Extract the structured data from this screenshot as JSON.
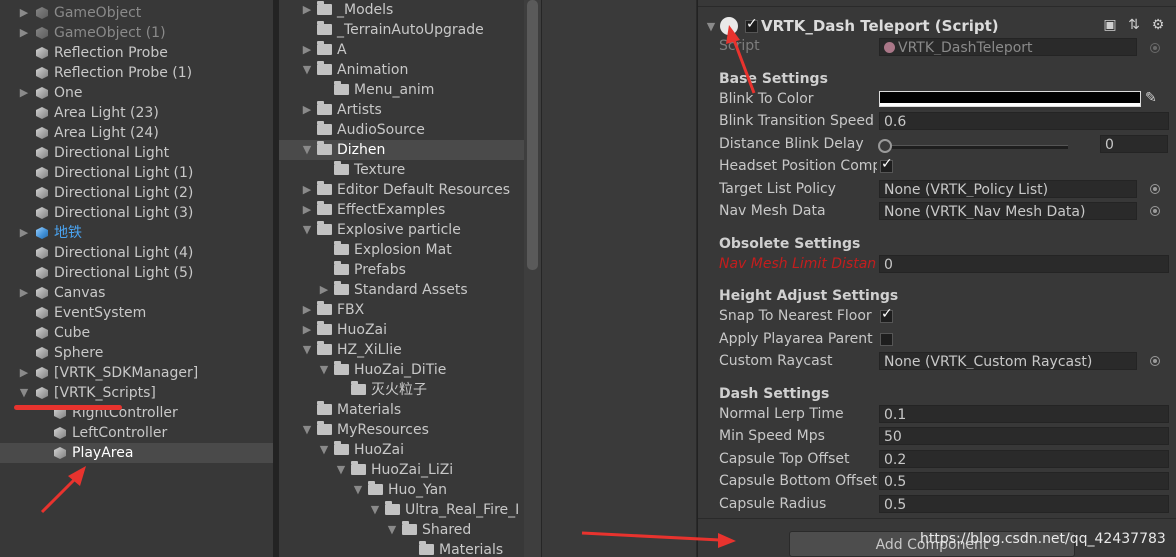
{
  "hierarchy": {
    "rows": [
      {
        "label": "GameObject",
        "arrow": "▶",
        "icon": "cube-dim",
        "style": "dim"
      },
      {
        "label": "GameObject (1)",
        "arrow": "▶",
        "icon": "cube-dim",
        "style": "dim"
      },
      {
        "label": "Reflection Probe",
        "arrow": "",
        "icon": "cube",
        "style": ""
      },
      {
        "label": "Reflection Probe (1)",
        "arrow": "",
        "icon": "cube",
        "style": ""
      },
      {
        "label": "One",
        "arrow": "▶",
        "icon": "cube",
        "style": ""
      },
      {
        "label": "Area Light (23)",
        "arrow": "",
        "icon": "cube",
        "style": ""
      },
      {
        "label": "Area Light (24)",
        "arrow": "",
        "icon": "cube",
        "style": ""
      },
      {
        "label": "Directional Light",
        "arrow": "",
        "icon": "cube",
        "style": ""
      },
      {
        "label": "Directional Light (1)",
        "arrow": "",
        "icon": "cube",
        "style": ""
      },
      {
        "label": "Directional Light (2)",
        "arrow": "",
        "icon": "cube",
        "style": ""
      },
      {
        "label": "Directional Light (3)",
        "arrow": "",
        "icon": "cube",
        "style": ""
      },
      {
        "label": "地铁",
        "arrow": "▶",
        "icon": "cube-blue",
        "style": "blue"
      },
      {
        "label": "Directional Light (4)",
        "arrow": "",
        "icon": "cube",
        "style": ""
      },
      {
        "label": "Directional Light (5)",
        "arrow": "",
        "icon": "cube",
        "style": ""
      },
      {
        "label": "Canvas",
        "arrow": "▶",
        "icon": "cube",
        "style": ""
      },
      {
        "label": "EventSystem",
        "arrow": "",
        "icon": "cube",
        "style": ""
      },
      {
        "label": "Cube",
        "arrow": "",
        "icon": "cube",
        "style": ""
      },
      {
        "label": "Sphere",
        "arrow": "",
        "icon": "cube",
        "style": ""
      },
      {
        "label": "[VRTK_SDKManager]",
        "arrow": "▶",
        "icon": "cube",
        "style": ""
      },
      {
        "label": "[VRTK_Scripts]",
        "arrow": "▼",
        "icon": "cube",
        "style": ""
      },
      {
        "label": "RightController",
        "arrow": "",
        "icon": "cube",
        "style": "",
        "indent": 1
      },
      {
        "label": "LeftController",
        "arrow": "",
        "icon": "cube",
        "style": "",
        "indent": 1
      },
      {
        "label": "PlayArea",
        "arrow": "",
        "icon": "cube",
        "style": "",
        "indent": 1,
        "selected": true
      }
    ]
  },
  "project": {
    "rows": [
      {
        "label": "_Models",
        "arrow": "▶",
        "indent": 0
      },
      {
        "label": "_TerrainAutoUpgrade",
        "arrow": "",
        "indent": 0
      },
      {
        "label": "A",
        "arrow": "▶",
        "indent": 0
      },
      {
        "label": "Animation",
        "arrow": "▼",
        "indent": 0
      },
      {
        "label": "Menu_anim",
        "arrow": "",
        "indent": 1
      },
      {
        "label": "Artists",
        "arrow": "▶",
        "indent": 0
      },
      {
        "label": "AudioSource",
        "arrow": "",
        "indent": 0
      },
      {
        "label": "Dizhen",
        "arrow": "▼",
        "indent": 0,
        "selected": true
      },
      {
        "label": "Texture",
        "arrow": "",
        "indent": 1
      },
      {
        "label": "Editor Default Resources",
        "arrow": "▶",
        "indent": 0
      },
      {
        "label": "EffectExamples",
        "arrow": "▶",
        "indent": 0
      },
      {
        "label": "Explosive particle",
        "arrow": "▼",
        "indent": 0
      },
      {
        "label": "Explosion Mat",
        "arrow": "",
        "indent": 1
      },
      {
        "label": "Prefabs",
        "arrow": "",
        "indent": 1
      },
      {
        "label": "Standard Assets",
        "arrow": "▶",
        "indent": 1
      },
      {
        "label": "FBX",
        "arrow": "▶",
        "indent": 0
      },
      {
        "label": "HuoZai",
        "arrow": "▶",
        "indent": 0
      },
      {
        "label": "HZ_XiLlie",
        "arrow": "▼",
        "indent": 0
      },
      {
        "label": "HuoZai_DiTie",
        "arrow": "▼",
        "indent": 1
      },
      {
        "label": "灭火粒子",
        "arrow": "",
        "indent": 2
      },
      {
        "label": "Materials",
        "arrow": "",
        "indent": 0
      },
      {
        "label": "MyResources",
        "arrow": "▼",
        "indent": 0
      },
      {
        "label": "HuoZai",
        "arrow": "▼",
        "indent": 1
      },
      {
        "label": "HuoZai_LiZi",
        "arrow": "▼",
        "indent": 2
      },
      {
        "label": "Huo_Yan",
        "arrow": "▼",
        "indent": 3
      },
      {
        "label": "Ultra_Real_Fire_I",
        "arrow": "▼",
        "indent": 4
      },
      {
        "label": "Shared",
        "arrow": "▼",
        "indent": 5
      },
      {
        "label": "Materials",
        "arrow": "",
        "indent": 6
      }
    ]
  },
  "inspector": {
    "component_title": "VRTK_Dash Teleport (Script)",
    "script_label": "Script",
    "script_value": "VRTK_DashTeleport",
    "base_settings": "Base Settings",
    "blink_to_color": "Blink To Color",
    "blink_transition_speed": "Blink Transition Speed",
    "blink_transition_speed_value": "0.6",
    "distance_blink_delay": "Distance Blink Delay",
    "distance_blink_delay_value": "0",
    "distance_blink_delay_fraction": 0,
    "headset_position_compensation": "Headset Position Comp",
    "headset_position_compensation_checked": true,
    "target_list_policy": "Target List Policy",
    "target_list_policy_value": "None (VRTK_Policy List)",
    "nav_mesh_data": "Nav Mesh Data",
    "nav_mesh_data_value": "None (VRTK_Nav Mesh Data)",
    "obsolete_settings": "Obsolete Settings",
    "nav_mesh_limit_distance": "Nav Mesh Limit Distan",
    "nav_mesh_limit_distance_value": "0",
    "height_adjust_settings": "Height Adjust Settings",
    "snap_to_nearest_floor": "Snap To Nearest Floor",
    "snap_to_nearest_floor_checked": true,
    "apply_playarea_parent": "Apply Playarea Parent",
    "apply_playarea_parent_checked": false,
    "custom_raycast": "Custom Raycast",
    "custom_raycast_value": "None (VRTK_Custom Raycast)",
    "dash_settings": "Dash Settings",
    "normal_lerp_time": "Normal Lerp Time",
    "normal_lerp_time_value": "0.1",
    "min_speed_mps": "Min Speed Mps",
    "min_speed_mps_value": "50",
    "capsule_top_offset": "Capsule Top Offset",
    "capsule_top_offset_value": "0.2",
    "capsule_bottom_offset": "Capsule Bottom Offset",
    "capsule_bottom_offset_value": "0.5",
    "capsule_radius": "Capsule Radius",
    "capsule_radius_value": "0.5",
    "add_component": "Add Component",
    "header_icons": [
      "book-icon",
      "settings-sliders-icon",
      "gear-icon"
    ]
  },
  "watermark": "https://blog.csdn.net/qq_42437783",
  "colors": {
    "annotation_red": "#e8332e",
    "selection": "#4a4a4a",
    "background": "#383838"
  }
}
